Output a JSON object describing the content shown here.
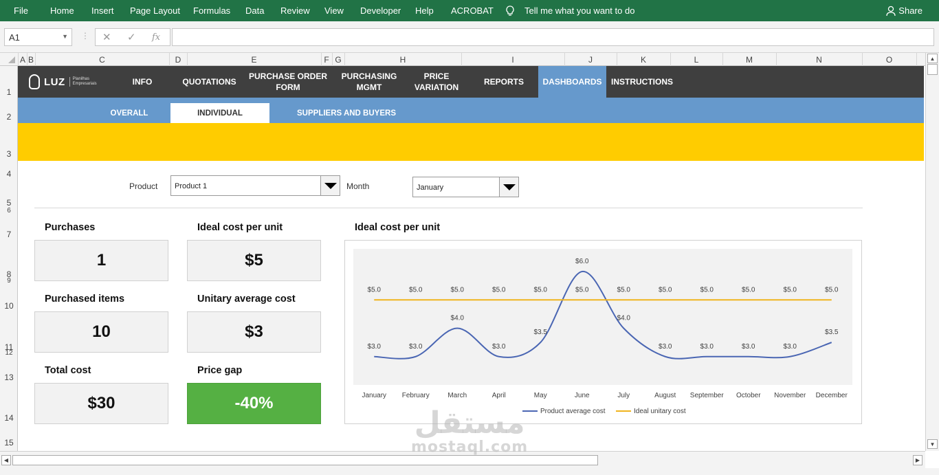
{
  "ribbon": {
    "tabs": [
      "File",
      "Home",
      "Insert",
      "Page Layout",
      "Formulas",
      "Data",
      "Review",
      "View",
      "Developer",
      "Help",
      "ACROBAT"
    ],
    "tell_me": "Tell me what you want to do",
    "share": "Share",
    "color": "#217346"
  },
  "formula_bar": {
    "name_box": "A1",
    "formula": "",
    "fx": "fx"
  },
  "columns": [
    "A",
    "B",
    "C",
    "D",
    "E",
    "F",
    "G",
    "H",
    "I",
    "J",
    "K",
    "L",
    "M",
    "N",
    "O"
  ],
  "rows": [
    "1",
    "2",
    "3",
    "4",
    "5",
    "6",
    "7",
    "8",
    "9",
    "10",
    "11",
    "12",
    "13",
    "14",
    "15"
  ],
  "header": {
    "logo": {
      "brand": "LUZ",
      "sub1": "Planilhas",
      "sub2": "Empresariais"
    },
    "nav": [
      {
        "l1": "INFO",
        "l2": ""
      },
      {
        "l1": "QUOTATIONS",
        "l2": ""
      },
      {
        "l1": "PURCHASE ORDER",
        "l2": "FORM"
      },
      {
        "l1": "PURCHASING",
        "l2": "MGMT"
      },
      {
        "l1": "PRICE",
        "l2": "VARIATION"
      },
      {
        "l1": "REPORTS",
        "l2": ""
      },
      {
        "l1": "DASHBOARDS",
        "l2": ""
      },
      {
        "l1": "INSTRUCTIONS",
        "l2": ""
      }
    ],
    "active_nav": "DASHBOARDS",
    "subnav": [
      "OVERALL",
      "INDIVIDUAL",
      "SUPPLIERS AND BUYERS"
    ],
    "active_subnav": "INDIVIDUAL"
  },
  "filters": {
    "product_label": "Product",
    "product_value": "Product 1",
    "month_label": "Month",
    "month_value": "January"
  },
  "kpis": {
    "purchases_label": "Purchases",
    "purchases_value": "1",
    "ideal_cost_label": "Ideal cost per unit",
    "ideal_cost_value": "$5",
    "purchased_items_label": "Purchased items",
    "purchased_items_value": "10",
    "unitary_avg_label": "Unitary average cost",
    "unitary_avg_value": "$3",
    "total_cost_label": "Total cost",
    "total_cost_value": "$30",
    "price_gap_label": "Price gap",
    "price_gap_value": "-40%",
    "price_gap_color": "#55b043"
  },
  "chart_data": {
    "type": "line",
    "title": "Ideal cost per unit",
    "x": [
      "January",
      "February",
      "March",
      "April",
      "May",
      "June",
      "July",
      "August",
      "September",
      "October",
      "November",
      "December"
    ],
    "series": [
      {
        "name": "Product average cost",
        "values": [
          3.0,
          3.0,
          4.0,
          3.0,
          3.5,
          6.0,
          4.0,
          3.0,
          3.0,
          3.0,
          3.0,
          3.5
        ],
        "color": "#4a66b3"
      },
      {
        "name": "Ideal unitary cost",
        "values": [
          5.0,
          5.0,
          5.0,
          5.0,
          5.0,
          5.0,
          5.0,
          5.0,
          5.0,
          5.0,
          5.0,
          5.0
        ],
        "color": "#f0b41e"
      }
    ],
    "data_label_format": "$0.0",
    "grid": false,
    "legend": "bottom",
    "plot_background": "#f2f2f2"
  },
  "watermark": {
    "arabic": "مستقل",
    "latin": "mostaql.com"
  }
}
